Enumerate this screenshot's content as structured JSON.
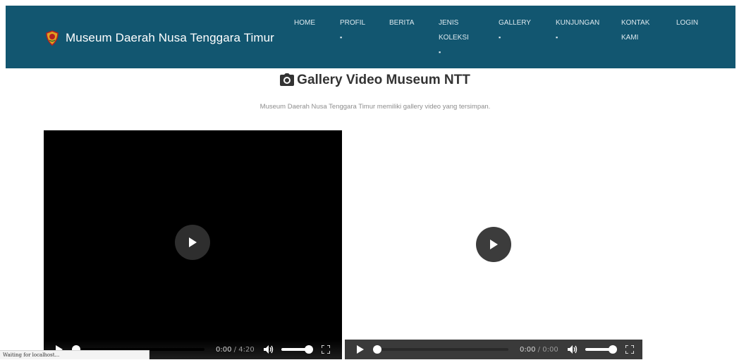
{
  "navbar": {
    "brand": "Museum Daerah Nusa Tenggara Timur",
    "items": [
      {
        "label": "HOME",
        "caret": ""
      },
      {
        "label": "PROFIL",
        "caret": "▪"
      },
      {
        "label": "BERITA",
        "caret": ""
      },
      {
        "label": "JENIS KOLEKSI",
        "line1": "JENIS",
        "line2": "KOLEKSI",
        "caret": "▪"
      },
      {
        "label": "GALLERY",
        "caret": "▪"
      },
      {
        "label": "KUNJUNGAN",
        "caret": "▪"
      },
      {
        "label": "KONTAK KAMI",
        "line1": "KONTAK",
        "line2": "KAMI",
        "caret": ""
      },
      {
        "label": "LOGIN",
        "caret": ""
      }
    ],
    "colors": {
      "background": "#125670"
    }
  },
  "page": {
    "title": "Gallery Video Museum NTT",
    "title_icon": "camera-icon",
    "subtitle": "Museum Daerah Nusa Tenggara Timur memiliki gallery video yang tersimpan."
  },
  "videos": [
    {
      "current_time": "0:00",
      "separator": "/",
      "duration": "4:20",
      "progress": 0.0,
      "volume": 1.0
    },
    {
      "current_time": "0:00",
      "separator": "/",
      "duration": "0:00",
      "progress": 0.0,
      "volume": 1.0
    }
  ],
  "status_bar": {
    "text": "Waiting for localhost..."
  }
}
